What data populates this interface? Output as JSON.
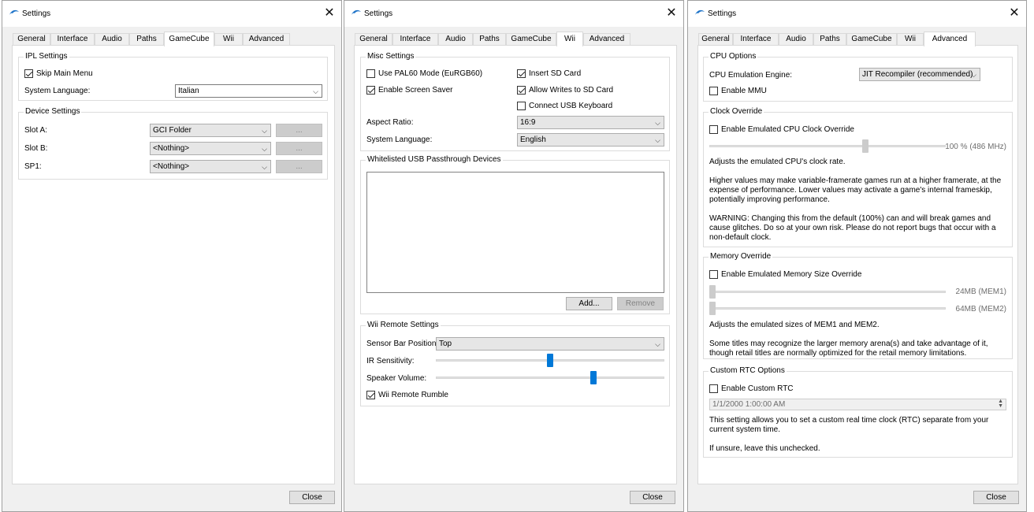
{
  "window_title": "Settings",
  "tabs": [
    "General",
    "Interface",
    "Audio",
    "Paths",
    "GameCube",
    "Wii",
    "Advanced"
  ],
  "close_label": "Close",
  "icons": {
    "app": "dolphin-icon",
    "close": "close-icon",
    "dropdown": "chevron-down-icon",
    "spinner": "up-down-arrows-icon"
  },
  "colors": {
    "slider_accent": "#0078d7"
  },
  "gamecube": {
    "active_tab": "GameCube",
    "ipl": {
      "title": "IPL Settings",
      "skip_main_menu": {
        "label": "Skip Main Menu",
        "checked": true
      },
      "system_language_label": "System Language:",
      "system_language_value": "Italian"
    },
    "device": {
      "title": "Device Settings",
      "slots": [
        {
          "label": "Slot A:",
          "value": "GCI Folder",
          "button": "..."
        },
        {
          "label": "Slot B:",
          "value": "<Nothing>",
          "button": "..."
        },
        {
          "label": "SP1:",
          "value": "<Nothing>",
          "button": "..."
        }
      ]
    }
  },
  "wii": {
    "active_tab": "Wii",
    "misc": {
      "title": "Misc Settings",
      "pal60": {
        "label": "Use PAL60 Mode (EuRGB60)",
        "checked": false
      },
      "screen_saver": {
        "label": "Enable Screen Saver",
        "checked": true
      },
      "insert_sd": {
        "label": "Insert SD Card",
        "checked": true
      },
      "allow_writes_sd": {
        "label": "Allow Writes to SD Card",
        "checked": true
      },
      "connect_usb_keyboard": {
        "label": "Connect USB Keyboard",
        "checked": false
      },
      "aspect_ratio_label": "Aspect Ratio:",
      "aspect_ratio_value": "16:9",
      "system_language_label": "System Language:",
      "system_language_value": "English"
    },
    "usb": {
      "title": "Whitelisted USB Passthrough Devices",
      "add_label": "Add...",
      "remove_label": "Remove"
    },
    "remote": {
      "title": "Wii Remote Settings",
      "sensor_bar_label": "Sensor Bar Position:",
      "sensor_bar_value": "Top",
      "ir_label": "IR Sensitivity:",
      "ir_fraction": 0.5,
      "speaker_label": "Speaker Volume:",
      "speaker_fraction": 0.69,
      "rumble": {
        "label": "Wii Remote Rumble",
        "checked": true
      }
    }
  },
  "advanced": {
    "active_tab": "Advanced",
    "cpu": {
      "title": "CPU Options",
      "engine_label": "CPU Emulation Engine:",
      "engine_value": "JIT Recompiler (recommended)",
      "enable_mmu": {
        "label": "Enable MMU",
        "checked": false
      }
    },
    "clock": {
      "title": "Clock Override",
      "enable": {
        "label": "Enable Emulated CPU Clock Override",
        "checked": false
      },
      "slider_fraction": 0.66,
      "value_text": "100 % (486 MHz)",
      "desc1": "Adjusts the emulated CPU's clock rate.",
      "desc2": "Higher values may make variable-framerate games run at a higher framerate, at the expense of performance. Lower values may activate a game's internal frameskip, potentially improving performance.",
      "desc3": "WARNING: Changing this from the default (100%) can and will break games and cause glitches. Do so at your own risk. Please do not report bugs that occur with a non-default clock."
    },
    "memory": {
      "title": "Memory Override",
      "enable": {
        "label": "Enable Emulated Memory Size Override",
        "checked": false
      },
      "mem1_text": "24MB (MEM1)",
      "mem2_text": "64MB (MEM2)",
      "desc1": "Adjusts the emulated sizes of MEM1 and MEM2.",
      "desc2": "Some titles may recognize the larger memory arena(s) and take advantage of it, though retail titles are normally optimized for the retail memory limitations."
    },
    "rtc": {
      "title": "Custom RTC Options",
      "enable": {
        "label": "Enable Custom RTC",
        "checked": false
      },
      "datetime_value": "1/1/2000 1:00:00 AM",
      "desc1": "This setting allows you to set a custom real time clock (RTC) separate from your current system time.",
      "desc2": "If unsure, leave this unchecked."
    }
  }
}
